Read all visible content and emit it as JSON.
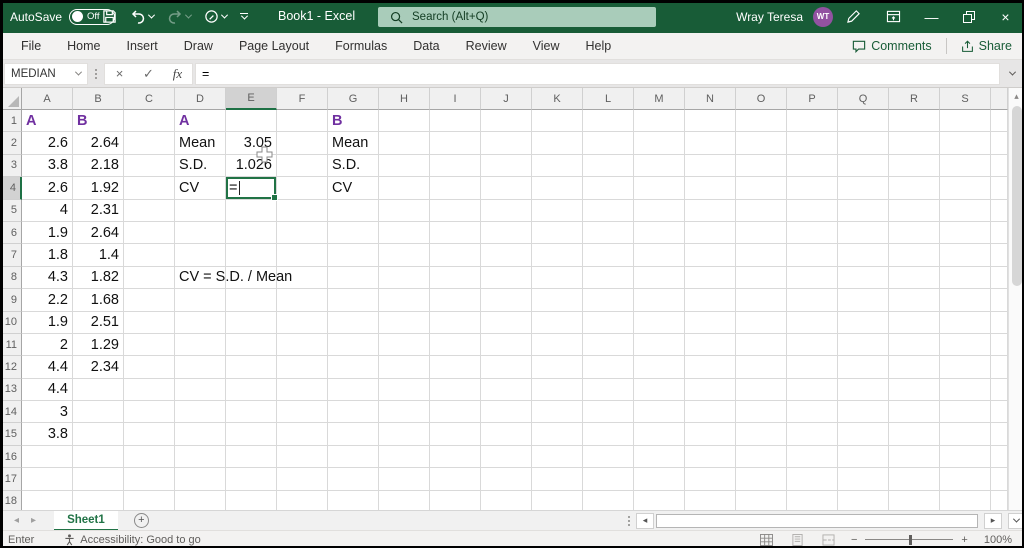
{
  "titlebar": {
    "autosave_label": "AutoSave",
    "autosave_state": "Off",
    "window_title": "Book1 - Excel",
    "search_placeholder": "Search (Alt+Q)",
    "user_name": "Wray Teresa",
    "user_initials": "WT"
  },
  "ribbon": {
    "tabs": [
      "File",
      "Home",
      "Insert",
      "Draw",
      "Page Layout",
      "Formulas",
      "Data",
      "Review",
      "View",
      "Help"
    ],
    "comments_label": "Comments",
    "share_label": "Share"
  },
  "formula_bar": {
    "name_box_value": "MEDIAN",
    "fx_label": "fx",
    "formula_value": "="
  },
  "grid": {
    "column_headers": [
      "A",
      "B",
      "C",
      "D",
      "E",
      "F",
      "G",
      "H",
      "I",
      "J",
      "K",
      "L",
      "M",
      "N",
      "O",
      "P",
      "Q",
      "R",
      "S"
    ],
    "row_headers": [
      "1",
      "2",
      "3",
      "4",
      "5",
      "6",
      "7",
      "8",
      "9",
      "10",
      "11",
      "12",
      "13",
      "14",
      "15",
      "16",
      "17",
      "18"
    ],
    "selected_column": "E",
    "selected_row": "4",
    "active_cell": {
      "col": "E",
      "row": "4",
      "value": "="
    },
    "cells": [
      {
        "col": "A",
        "row": "1",
        "text": "A",
        "style": "purple"
      },
      {
        "col": "B",
        "row": "1",
        "text": "B",
        "style": "purple"
      },
      {
        "col": "D",
        "row": "1",
        "text": "A",
        "style": "purple"
      },
      {
        "col": "G",
        "row": "1",
        "text": "B",
        "style": "purple"
      },
      {
        "col": "A",
        "row": "2",
        "text": "2.6",
        "style": "num"
      },
      {
        "col": "A",
        "row": "3",
        "text": "3.8",
        "style": "num"
      },
      {
        "col": "A",
        "row": "4",
        "text": "2.6",
        "style": "num"
      },
      {
        "col": "A",
        "row": "5",
        "text": "4",
        "style": "num"
      },
      {
        "col": "A",
        "row": "6",
        "text": "1.9",
        "style": "num"
      },
      {
        "col": "A",
        "row": "7",
        "text": "1.8",
        "style": "num"
      },
      {
        "col": "A",
        "row": "8",
        "text": "4.3",
        "style": "num"
      },
      {
        "col": "A",
        "row": "9",
        "text": "2.2",
        "style": "num"
      },
      {
        "col": "A",
        "row": "10",
        "text": "1.9",
        "style": "num"
      },
      {
        "col": "A",
        "row": "11",
        "text": "2",
        "style": "num"
      },
      {
        "col": "A",
        "row": "12",
        "text": "4.4",
        "style": "num"
      },
      {
        "col": "A",
        "row": "13",
        "text": "4.4",
        "style": "num"
      },
      {
        "col": "A",
        "row": "14",
        "text": "3",
        "style": "num"
      },
      {
        "col": "A",
        "row": "15",
        "text": "3.8",
        "style": "num"
      },
      {
        "col": "B",
        "row": "2",
        "text": "2.64",
        "style": "num"
      },
      {
        "col": "B",
        "row": "3",
        "text": "2.18",
        "style": "num"
      },
      {
        "col": "B",
        "row": "4",
        "text": "1.92",
        "style": "num"
      },
      {
        "col": "B",
        "row": "5",
        "text": "2.31",
        "style": "num"
      },
      {
        "col": "B",
        "row": "6",
        "text": "2.64",
        "style": "num"
      },
      {
        "col": "B",
        "row": "7",
        "text": "1.4",
        "style": "num"
      },
      {
        "col": "B",
        "row": "8",
        "text": "1.82",
        "style": "num"
      },
      {
        "col": "B",
        "row": "9",
        "text": "1.68",
        "style": "num"
      },
      {
        "col": "B",
        "row": "10",
        "text": "2.51",
        "style": "num"
      },
      {
        "col": "B",
        "row": "11",
        "text": "1.29",
        "style": "num"
      },
      {
        "col": "B",
        "row": "12",
        "text": "2.34",
        "style": "num"
      },
      {
        "col": "D",
        "row": "2",
        "text": "Mean",
        "style": "label"
      },
      {
        "col": "E",
        "row": "2",
        "text": "3.05",
        "style": "num"
      },
      {
        "col": "D",
        "row": "3",
        "text": "S.D.",
        "style": "label"
      },
      {
        "col": "E",
        "row": "3",
        "text": "1.026",
        "style": "num"
      },
      {
        "col": "D",
        "row": "4",
        "text": "CV",
        "style": "label"
      },
      {
        "col": "G",
        "row": "2",
        "text": "Mean",
        "style": "label"
      },
      {
        "col": "G",
        "row": "3",
        "text": "S.D.",
        "style": "label"
      },
      {
        "col": "G",
        "row": "4",
        "text": "CV",
        "style": "label"
      },
      {
        "col": "D",
        "row": "8",
        "text": "CV = S.D. / Mean",
        "style": "note"
      }
    ]
  },
  "sheet_bar": {
    "active_tab": "Sheet1"
  },
  "status_bar": {
    "mode": "Enter",
    "accessibility_text": "Accessibility: Good to go",
    "zoom_level": "100%"
  }
}
